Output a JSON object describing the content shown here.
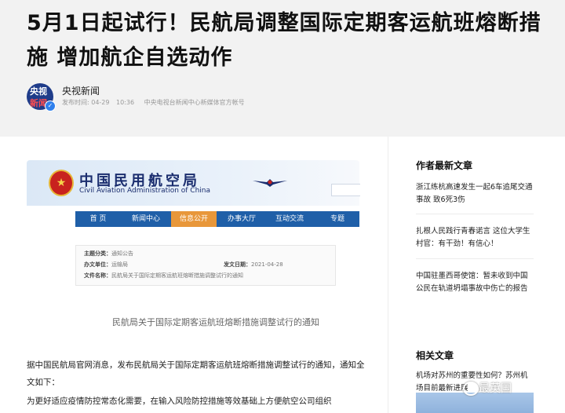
{
  "article": {
    "title": "5月1日起试行！民航局调整国际定期客运航班熔断措施 增加航企自选动作",
    "source": {
      "avatar_line1": "央视",
      "avatar_line2": "新闻",
      "name": "央视新闻",
      "published_label": "发布时间: 04-29",
      "time": "10:36",
      "account_desc": "中央电视台新闻中心新媒体官方帐号"
    },
    "image": {
      "site_cn": "中国民用航空局",
      "site_en": "Civil Aviation Administration of China",
      "nav": [
        "首 页",
        "新闻中心",
        "信息公开",
        "办事大厅",
        "互动交流",
        "专题"
      ],
      "notice": {
        "category_label": "主题分类：",
        "category_value": "通知公告",
        "issuer_label": "办文单位：",
        "issuer_value": "运输局",
        "date_label": "发文日期：",
        "date_value": "2021-04-28",
        "name_label": "文件名称：",
        "name_value": "民航局关于国际定期客运航班熔断措施调整试行的通知"
      },
      "notice_title": "民航局关于国际定期客运航班熔断措施调整试行的通知"
    },
    "paragraph1": "据中国民航局官网消息，发布民航局关于国际定期客运航班熔断措施调整试行的通知，通知全文如下：",
    "paragraph2": "为更好适应疫情防控常态化需要，在输入风险防控措施等效基础上方便航空公司组织"
  },
  "sidebar": {
    "latest_title": "作者最新文章",
    "latest": [
      "浙江练杭高速发生一起6车追尾交通事故 致6死3伤",
      "扎根人民践行青春诺言 这位大学生村官：有干劲！有信心！",
      "中国驻墨西哥使馆：暂未收到中国公民在轨道坍塌事故中伤亡的报告"
    ],
    "related_title": "相关文章",
    "related": [
      "机场对苏州的重要性如何？苏州机场目前最新进展"
    ]
  },
  "watermark": "最英国"
}
